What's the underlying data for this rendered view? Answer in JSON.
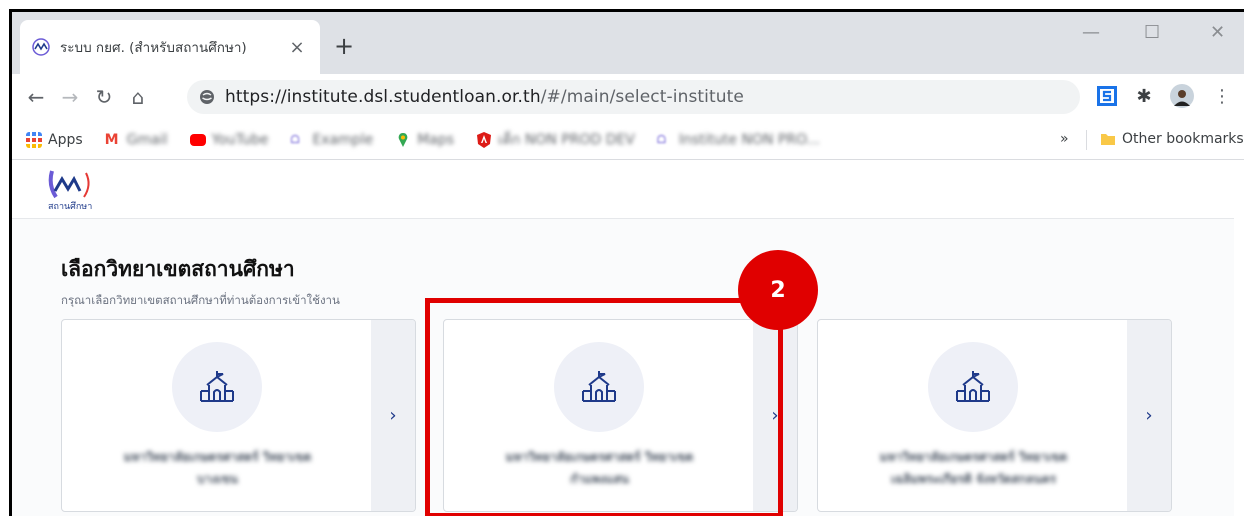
{
  "browser": {
    "tab_title": "ระบบ กยศ. (สำหรับสถานศึกษา)",
    "url_host": "https://institute.dsl.studentloan.or.th",
    "url_path": "/#/main/select-institute",
    "bookmarks": [
      {
        "label": "Apps",
        "icon": "apps-grid-icon",
        "color": "#4285f4"
      },
      {
        "label": "Gmail",
        "icon": "gmail-icon",
        "color": "#ea4335"
      },
      {
        "label": "YouTube",
        "icon": "youtube-icon",
        "color": "#ff0000"
      },
      {
        "label": "Example",
        "icon": "dsl-logo-icon",
        "color": "#6b5bd6"
      },
      {
        "label": "Maps",
        "icon": "maps-icon",
        "color": "#34a853"
      },
      {
        "label": "เด็ก NON PROD DEV",
        "icon": "angular-icon",
        "color": "#dd1b16"
      },
      {
        "label": "Institute NON PRO...",
        "icon": "dsl-logo-icon",
        "color": "#6b5bd6"
      }
    ],
    "overflow_label": "»",
    "other_bookmarks": "Other bookmarks"
  },
  "app": {
    "logo_text": "สถานศึกษา",
    "title": "เลือกวิทยาเขตสถานศึกษา",
    "subtitle": "กรุณาเลือกวิทยาเขตสถานศึกษาที่ท่านต้องการเข้าใช้งาน"
  },
  "cards": [
    {
      "line1": "มหาวิทยาลัยเกษตรศาสตร์ วิทยาเขต",
      "line2": "บางเขน"
    },
    {
      "line1": "มหาวิทยาลัยเกษตรศาสตร์ วิทยาเขต",
      "line2": "กำแพงแสน"
    },
    {
      "line1": "มหาวิทยาลัยเกษตรศาสตร์ วิทยาเขต",
      "line2": "เฉลิมพระเกียรติ จังหวัดสกลนคร"
    }
  ],
  "annotation": {
    "step": "2",
    "color": "#e00000"
  }
}
